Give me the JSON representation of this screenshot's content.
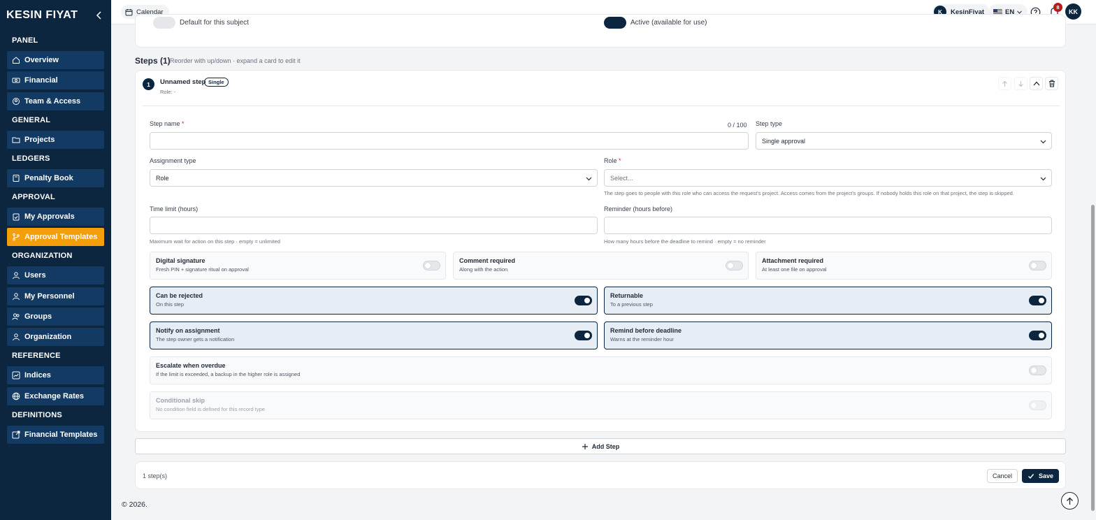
{
  "brand": {
    "logo_text": "KESIN FIYAT"
  },
  "sidebar": {
    "sections": [
      {
        "title": "PANEL",
        "items": [
          {
            "label": "Overview",
            "icon": "home-icon"
          },
          {
            "label": "Financial",
            "icon": "money-icon"
          },
          {
            "label": "Team & Access",
            "icon": "shield-user-icon"
          }
        ]
      },
      {
        "title": "GENERAL",
        "items": [
          {
            "label": "Projects",
            "icon": "folder-icon"
          }
        ]
      },
      {
        "title": "LEDGERS",
        "items": [
          {
            "label": "Penalty Book",
            "icon": "book-icon"
          }
        ]
      },
      {
        "title": "APPROVAL",
        "items": [
          {
            "label": "My Approvals",
            "icon": "clipboard-check-icon"
          },
          {
            "label": "Approval Templates",
            "icon": "branch-icon",
            "active": true
          }
        ]
      },
      {
        "title": "ORGANIZATION",
        "items": [
          {
            "label": "Users",
            "icon": "user-icon"
          },
          {
            "label": "My Personnel",
            "icon": "personnel-icon"
          },
          {
            "label": "Groups",
            "icon": "users-icon"
          },
          {
            "label": "Organization",
            "icon": "org-icon"
          }
        ]
      },
      {
        "title": "REFERENCE",
        "items": [
          {
            "label": "Indices",
            "icon": "chart-icon"
          },
          {
            "label": "Exchange Rates",
            "icon": "globe-icon"
          }
        ]
      },
      {
        "title": "DEFINITIONS",
        "items": [
          {
            "label": "Financial Templates",
            "icon": "external-edit-icon"
          }
        ]
      }
    ]
  },
  "topbar": {
    "calendar_label": "Calendar",
    "user_initial": "K",
    "user_name": "KesinFiyat",
    "language": "EN",
    "notification_count": "8",
    "avatar_initials": "KK"
  },
  "top_card": {
    "left_toggle_text": "Default for this subject",
    "right_toggle_text": "Active (available for use)"
  },
  "steps": {
    "title": "Steps (1)",
    "subtitle": "Reorder with up/down · expand a card to edit it",
    "card": {
      "number": "1",
      "name": "Unnamed step",
      "badge": "Single",
      "role_line": "Role: -"
    },
    "fields": {
      "step_name_label": "Step name",
      "required_mark": "*",
      "step_name_counter": "0 / 100",
      "step_name_value": "",
      "step_type_label": "Step type",
      "step_type_value": "Single approval",
      "assignment_type_label": "Assignment type",
      "assignment_type_value": "Role",
      "role_label": "Role",
      "role_placeholder": "Select...",
      "role_help": "The step goes to people with this role who can access the request's project. Access comes from the project's groups. If nobody holds this role on that project, the step is skipped.",
      "time_limit_label": "Time limit (hours)",
      "time_limit_help": "Maximum wait for action on this step · empty = unlimited",
      "reminder_label": "Reminder (hours before)",
      "reminder_help": "How many hours before the deadline to remind · empty = no reminder"
    },
    "options": [
      {
        "title": "Digital signature",
        "sub": "Fresh PIN + signature ritual on approval",
        "on": false
      },
      {
        "title": "Comment required",
        "sub": "Along with the action",
        "on": false
      },
      {
        "title": "Attachment required",
        "sub": "At least one file on approval",
        "on": false
      },
      {
        "title": "Can be rejected",
        "sub": "On this step",
        "on": true
      },
      {
        "title": "Returnable",
        "sub": "To a previous step",
        "on": true
      },
      {
        "title": "Notify on assignment",
        "sub": "The step owner gets a notification",
        "on": true
      },
      {
        "title": "Remind before deadline",
        "sub": "Warns at the reminder hour",
        "on": true
      },
      {
        "title": "Escalate when overdue",
        "sub": "If the limit is exceeded, a backup in the higher role is assigned",
        "on": false
      },
      {
        "title": "Conditional skip",
        "sub": "No condition field is defined for this record type",
        "on": false,
        "disabled": true
      }
    ]
  },
  "add_step_label": "Add Step",
  "footer": {
    "step_count": "1 step(s)",
    "cancel_label": "Cancel",
    "save_label": "Save"
  },
  "copyright": "© 2026.",
  "colors": {
    "navy": "#0c2640",
    "accent": "#f59e0b",
    "nav_item": "#123a63"
  }
}
